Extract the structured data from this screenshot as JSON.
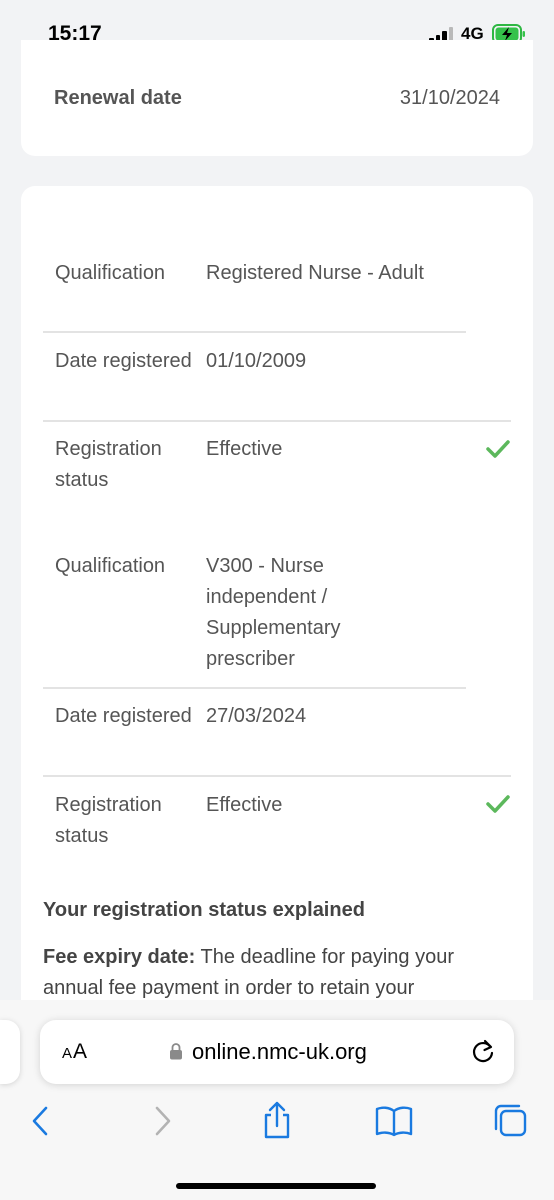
{
  "status_bar": {
    "time": "15:17",
    "network": "4G"
  },
  "summary": {
    "renewal_label": "Renewal date",
    "renewal_value": "31/10/2024"
  },
  "qualifications": [
    {
      "qualification_label": "Qualification",
      "qualification_value": "Registered Nurse - Adult",
      "date_label": "Date registered",
      "date_value": "01/10/2009",
      "status_label": "Registration status",
      "status_value": "Effective"
    },
    {
      "qualification_label": "Qualification",
      "qualification_value": "V300 - Nurse independent / Supplementary prescriber",
      "date_label": "Date registered",
      "date_value": "27/03/2024",
      "status_label": "Registration status",
      "status_value": "Effective"
    }
  ],
  "explained": {
    "title": "Your registration status explained",
    "fee_term": "Fee expiry date:",
    "fee_text": " The deadline for paying your annual fee payment in order to retain your"
  },
  "browser": {
    "text_size_label_big": "A",
    "text_size_label_small": "A",
    "url": "online.nmc-uk.org"
  },
  "colors": {
    "check": "#5cb85c",
    "accent": "#1a7ae0"
  }
}
